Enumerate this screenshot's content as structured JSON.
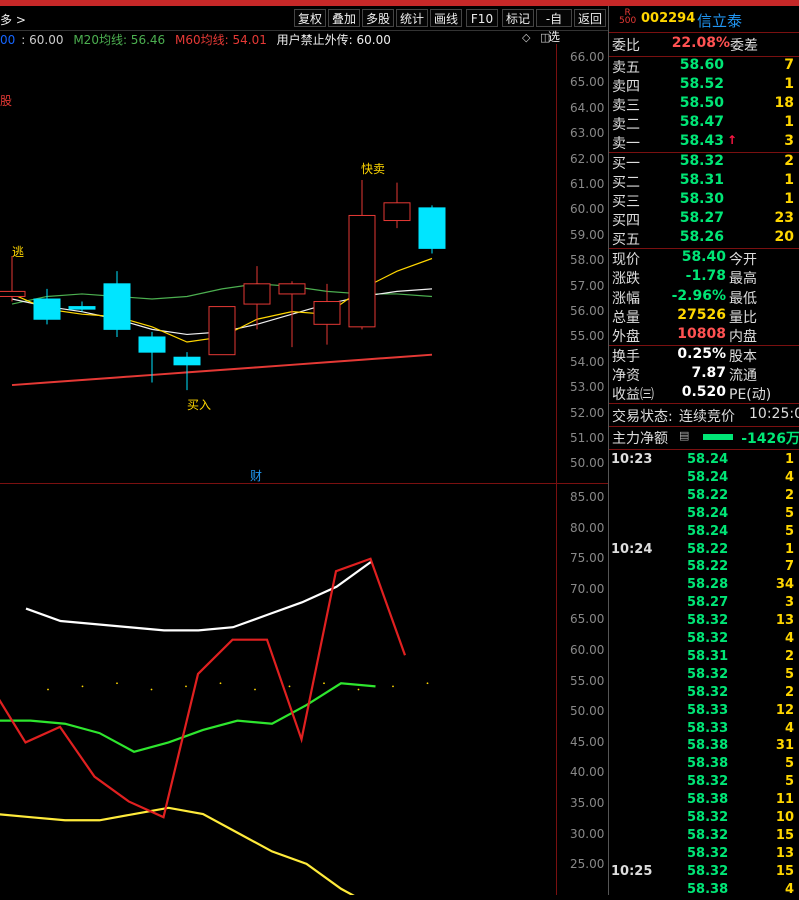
{
  "toolbar": {
    "left_text": "多 >",
    "buttons": [
      "复权",
      "叠加",
      "多股",
      "统计",
      "画线",
      "F10",
      "标记",
      "-自选",
      "返回"
    ]
  },
  "legend": {
    "ma5": "00",
    "v60": ": 60.00",
    "m20": "M20均线: 56.46",
    "m60": "M60均线: 54.01",
    "note": "用户禁止外传: 60.00"
  },
  "price_axis": [
    "66.00",
    "65.00",
    "64.00",
    "63.00",
    "62.00",
    "61.00",
    "60.00",
    "59.00",
    "58.00",
    "57.00",
    "56.00",
    "55.00",
    "54.00",
    "53.00",
    "52.00",
    "51.00",
    "50.00"
  ],
  "indicator_axis": [
    "85.00",
    "80.00",
    "75.00",
    "70.00",
    "65.00",
    "60.00",
    "55.00",
    "50.00",
    "45.00",
    "40.00",
    "35.00",
    "30.00",
    "25.00"
  ],
  "annotations": {
    "stock_label": "股",
    "escape": "逃",
    "quick_sell": "快卖",
    "buy": "买入",
    "finance": "财"
  },
  "chart_data": {
    "type": "candlestick",
    "ylim": [
      50,
      66
    ],
    "candles": [
      {
        "o": 56.5,
        "c": 56.7,
        "h": 58.1,
        "l": 56.3
      },
      {
        "o": 56.4,
        "c": 55.6,
        "h": 56.8,
        "l": 55.4
      },
      {
        "o": 56.1,
        "c": 56.0,
        "h": 56.3,
        "l": 55.9
      },
      {
        "o": 57.0,
        "c": 55.2,
        "h": 57.5,
        "l": 54.9
      },
      {
        "o": 54.9,
        "c": 54.3,
        "h": 55.1,
        "l": 53.1
      },
      {
        "o": 54.1,
        "c": 53.8,
        "h": 54.3,
        "l": 52.8
      },
      {
        "o": 54.2,
        "c": 56.1,
        "h": 56.1,
        "l": 54.2
      },
      {
        "o": 56.2,
        "c": 57.0,
        "h": 57.7,
        "l": 55.2
      },
      {
        "o": 56.6,
        "c": 57.0,
        "h": 57.1,
        "l": 54.5
      },
      {
        "o": 55.4,
        "c": 56.3,
        "h": 57.0,
        "l": 54.6
      },
      {
        "o": 55.3,
        "c": 59.7,
        "h": 61.1,
        "l": 55.2
      },
      {
        "o": 59.5,
        "c": 60.2,
        "h": 61.0,
        "l": 59.2
      },
      {
        "o": 60.0,
        "c": 58.4,
        "h": 60.1,
        "l": 58.2
      }
    ],
    "ma_white": [
      56.4,
      56.1,
      55.9,
      55.6,
      55.2,
      55.0,
      55.1,
      55.4,
      55.8,
      56.2,
      56.5,
      56.7,
      56.8
    ],
    "ma_yellow": [
      56.6,
      56.0,
      55.8,
      55.7,
      55.3,
      54.7,
      54.9,
      55.6,
      55.9,
      55.8,
      56.8,
      57.5,
      58.0
    ],
    "ma_green": [
      56.2,
      56.5,
      56.6,
      56.5,
      56.4,
      56.5,
      56.8,
      57.0,
      56.9,
      56.7,
      56.6,
      56.6,
      56.5
    ],
    "ma_red": [
      53.0,
      53.1,
      53.2,
      53.3,
      53.4,
      53.5,
      53.6,
      53.7,
      53.8,
      53.9,
      54.0,
      54.1,
      54.2
    ],
    "indicator_ylim": [
      22,
      88
    ],
    "ind_white": [
      68,
      66,
      65.5,
      65,
      64.5,
      64.5,
      65,
      67,
      69,
      71.5,
      75.5
    ],
    "ind_red": [
      55.5,
      46.5,
      49,
      41,
      37,
      34.5,
      57.5,
      63,
      63,
      47,
      74,
      76,
      60.5
    ],
    "ind_green": [
      50,
      50,
      49.5,
      48,
      45,
      46.5,
      48.5,
      50,
      49.5,
      52.5,
      56,
      55.5
    ],
    "ind_yellow": [
      35,
      34.5,
      34,
      34,
      35,
      36,
      35,
      32,
      29,
      27,
      23,
      20
    ]
  },
  "stock": {
    "badge_r": "R",
    "badge_num": "500",
    "code": "002294",
    "name": "信立泰"
  },
  "weibi": {
    "label": "委比",
    "value": "22.08%",
    "label2": "委差"
  },
  "sells": [
    {
      "label": "卖五",
      "price": "58.60",
      "vol": "7"
    },
    {
      "label": "卖四",
      "price": "58.52",
      "vol": "1"
    },
    {
      "label": "卖三",
      "price": "58.50",
      "vol": "18"
    },
    {
      "label": "卖二",
      "price": "58.47",
      "vol": "1"
    },
    {
      "label": "卖一",
      "price": "58.43",
      "vol": "3"
    }
  ],
  "buys": [
    {
      "label": "买一",
      "price": "58.32",
      "vol": "2"
    },
    {
      "label": "买二",
      "price": "58.31",
      "vol": "1"
    },
    {
      "label": "买三",
      "price": "58.30",
      "vol": "1"
    },
    {
      "label": "买四",
      "price": "58.27",
      "vol": "23"
    },
    {
      "label": "买五",
      "price": "58.26",
      "vol": "20"
    }
  ],
  "quote": [
    {
      "l": "现价",
      "v": "58.40",
      "vc": "green",
      "l2": "今开"
    },
    {
      "l": "涨跌",
      "v": "-1.78",
      "vc": "green",
      "l2": "最高"
    },
    {
      "l": "涨幅",
      "v": "-2.96%",
      "vc": "green",
      "l2": "最低"
    },
    {
      "l": "总量",
      "v": "27526",
      "vc": "yellow",
      "l2": "量比"
    },
    {
      "l": "外盘",
      "v": "10808",
      "vc": "red",
      "l2": "内盘"
    }
  ],
  "quote2": [
    {
      "l": "换手",
      "v": "0.25%",
      "l2": "股本"
    },
    {
      "l": "净资",
      "v": "7.87",
      "l2": "流通"
    },
    {
      "l": "收益㈢",
      "v": "0.520",
      "l2": "PE(动)"
    }
  ],
  "status": {
    "label": "交易状态:",
    "value": "连续竞价",
    "time": "10:25:0"
  },
  "flow": {
    "label": "主力净额",
    "value": "-1426万"
  },
  "ticks": [
    {
      "t": "10:23",
      "p": "58.24",
      "q": "1"
    },
    {
      "t": "",
      "p": "58.24",
      "q": "4"
    },
    {
      "t": "",
      "p": "58.22",
      "q": "2"
    },
    {
      "t": "",
      "p": "58.24",
      "q": "5"
    },
    {
      "t": "",
      "p": "58.24",
      "q": "5"
    },
    {
      "t": "10:24",
      "p": "58.22",
      "q": "1"
    },
    {
      "t": "",
      "p": "58.22",
      "q": "7"
    },
    {
      "t": "",
      "p": "58.28",
      "q": "34"
    },
    {
      "t": "",
      "p": "58.27",
      "q": "3"
    },
    {
      "t": "",
      "p": "58.32",
      "q": "13"
    },
    {
      "t": "",
      "p": "58.32",
      "q": "4"
    },
    {
      "t": "",
      "p": "58.31",
      "q": "2"
    },
    {
      "t": "",
      "p": "58.32",
      "q": "5"
    },
    {
      "t": "",
      "p": "58.32",
      "q": "2"
    },
    {
      "t": "",
      "p": "58.33",
      "q": "12"
    },
    {
      "t": "",
      "p": "58.33",
      "q": "4"
    },
    {
      "t": "",
      "p": "58.38",
      "q": "31"
    },
    {
      "t": "",
      "p": "58.38",
      "q": "5"
    },
    {
      "t": "",
      "p": "58.32",
      "q": "5"
    },
    {
      "t": "",
      "p": "58.38",
      "q": "11"
    },
    {
      "t": "",
      "p": "58.32",
      "q": "10"
    },
    {
      "t": "",
      "p": "58.32",
      "q": "15"
    },
    {
      "t": "",
      "p": "58.32",
      "q": "13"
    },
    {
      "t": "10:25",
      "p": "58.32",
      "q": "15"
    },
    {
      "t": "",
      "p": "58.38",
      "q": "4"
    }
  ]
}
